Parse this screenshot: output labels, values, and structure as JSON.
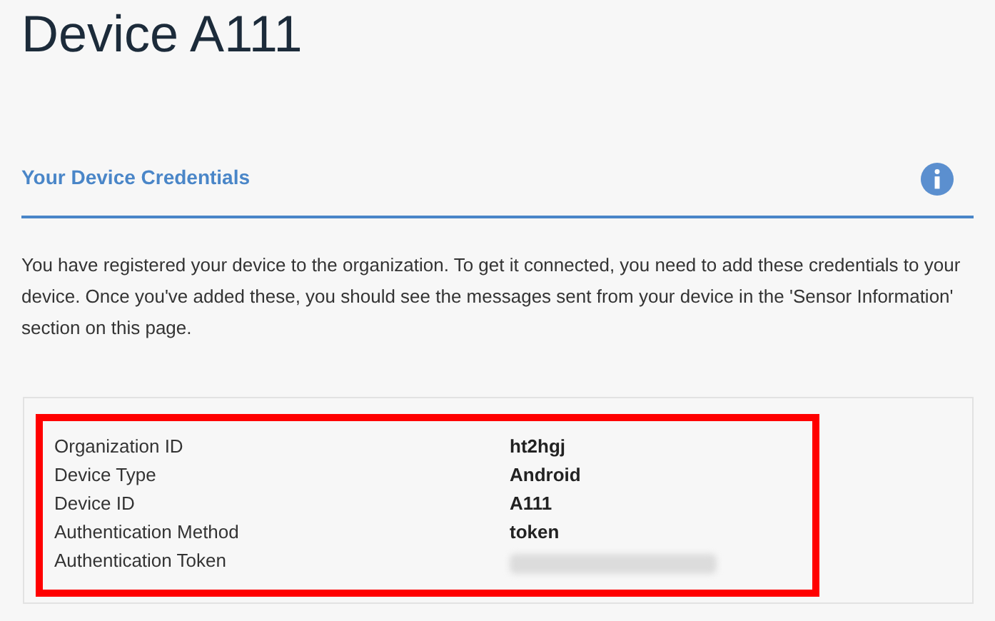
{
  "title": "Device A111",
  "section": {
    "heading": "Your Device Credentials",
    "description": "You have registered your device to the organization. To get it connected, you need to add these credentials to your device. Once you've added these, you should see the messages sent from your device in the 'Sensor Information' section on this page."
  },
  "credentials": [
    {
      "label": "Organization ID",
      "kind": "text",
      "value": "ht2hgj"
    },
    {
      "label": "Device Type",
      "kind": "text",
      "value": "Android"
    },
    {
      "label": "Device ID",
      "kind": "text",
      "value": "A111"
    },
    {
      "label": "Authentication Method",
      "kind": "text",
      "value": "token"
    },
    {
      "label": "Authentication Token",
      "kind": "blurred"
    }
  ]
}
